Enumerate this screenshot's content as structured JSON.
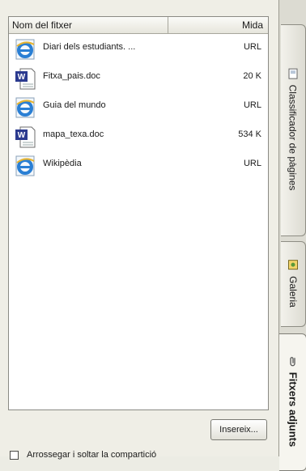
{
  "list": {
    "col_name": "Nom del fitxer",
    "col_size": "Mida",
    "rows": [
      {
        "name": "Diari dels estudiants. ...",
        "size": "URL",
        "icon": "ie-icon"
      },
      {
        "name": "Fitxa_pais.doc",
        "size": "20 K",
        "icon": "word-doc-icon"
      },
      {
        "name": "Guia del mundo",
        "size": "URL",
        "icon": "ie-icon"
      },
      {
        "name": "mapa_texa.doc",
        "size": "534 K",
        "icon": "word-doc-icon"
      },
      {
        "name": "Wikipèdia",
        "size": "URL",
        "icon": "ie-icon"
      }
    ]
  },
  "insert_button": "Insereix...",
  "checkbox_label": "Arrossegar i soltar la compartició",
  "tabs": [
    {
      "label": "Classificador de pàgines",
      "icon": "page-sorter-icon"
    },
    {
      "label": "Galeria",
      "icon": "gallery-icon"
    },
    {
      "label": "Fitxers adjunts",
      "icon": "paperclip-icon"
    }
  ],
  "colors": {
    "panel_bg": "#efeee6",
    "ie_blue": "#2a7fd4",
    "word_blue": "#2b3a8f"
  }
}
